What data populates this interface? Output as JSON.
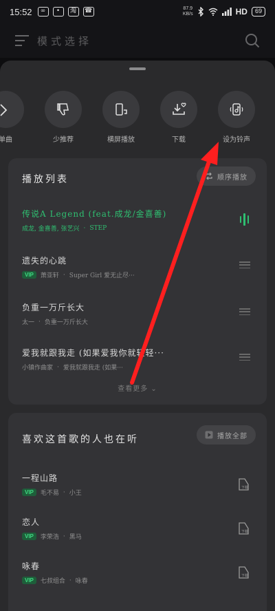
{
  "status_bar": {
    "time": "15:52",
    "app_icons": [
      "∞",
      "•",
      "淘",
      "☎"
    ],
    "speed_top": "87.9",
    "speed_bottom": "KB/s",
    "network": "HD",
    "battery": "69"
  },
  "header": {
    "title": "模式选择"
  },
  "actions": [
    {
      "label": "单曲",
      "icon": "partial-icon"
    },
    {
      "label": "少推荐",
      "icon": "thumb-down-icon"
    },
    {
      "label": "横屏播放",
      "icon": "landscape-icon"
    },
    {
      "label": "下载",
      "icon": "download-icon"
    },
    {
      "label": "设为铃声",
      "icon": "ringtone-icon"
    }
  ],
  "playlist": {
    "title": "播放列表",
    "mode_label": "顺序播放",
    "songs": [
      {
        "title": "传说A Legend (feat.成龙/金喜善)",
        "artist": "成龙, 金喜善, 张艺兴",
        "album": "STEP",
        "vip": false,
        "active": true
      },
      {
        "title": "遗失的心跳",
        "artist": "萧亚轩",
        "album": "Super Girl 爱无止尽···",
        "vip": true,
        "active": false
      },
      {
        "title": "负重一万斤长大",
        "artist": "太一",
        "album": "负重一万斤长大",
        "vip": false,
        "active": false
      },
      {
        "title": "爱我就跟我走 (如果爱我你就轻轻···",
        "artist": "小镇作曲家",
        "album": "爱我就跟我走 (如果···",
        "vip": false,
        "active": false
      }
    ],
    "more_label": "查看更多"
  },
  "recommend": {
    "title": "喜欢这首歌的人也在听",
    "play_all_label": "播放全部",
    "songs": [
      {
        "title": "一程山路",
        "artist": "毛不易",
        "album": "小王",
        "vip": true
      },
      {
        "title": "恋人",
        "artist": "李荣浩",
        "album": "黑马",
        "vip": true
      },
      {
        "title": "咏春",
        "artist": "七叔组合",
        "album": "咏春",
        "vip": true
      }
    ]
  },
  "colors": {
    "accent": "#2fbf71",
    "arrow": "#ff1f1f",
    "sheet": "#2a2a2c",
    "card": "#333336"
  }
}
